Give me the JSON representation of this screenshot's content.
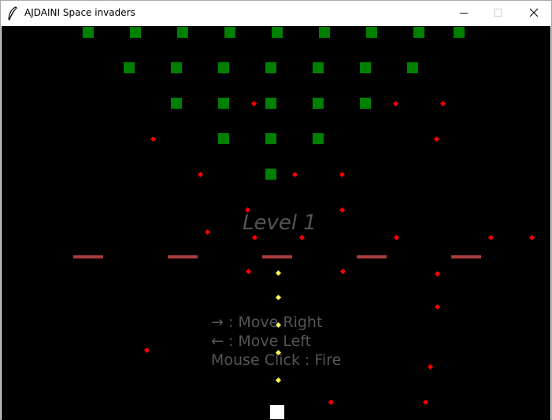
{
  "window": {
    "title": "AJDAINI Space invaders",
    "icon": "feather-icon",
    "controls": [
      "minimize-icon",
      "maximize-icon",
      "close-icon"
    ]
  },
  "game": {
    "level_text": "Level 1",
    "instructions": [
      "→ : Move Right",
      "← : Move Left",
      "Mouse Click : Fire"
    ],
    "invader_rows": [
      9,
      7,
      5,
      3,
      1
    ],
    "shield_count": 5,
    "colors": {
      "background": "#000000",
      "invader": "#008000",
      "shield": "#aa3c3c",
      "enemy_bullet": "#ff0000",
      "player_bullet": "#ffff55",
      "player": "#ffffff",
      "overlay_text": "#555555"
    }
  }
}
